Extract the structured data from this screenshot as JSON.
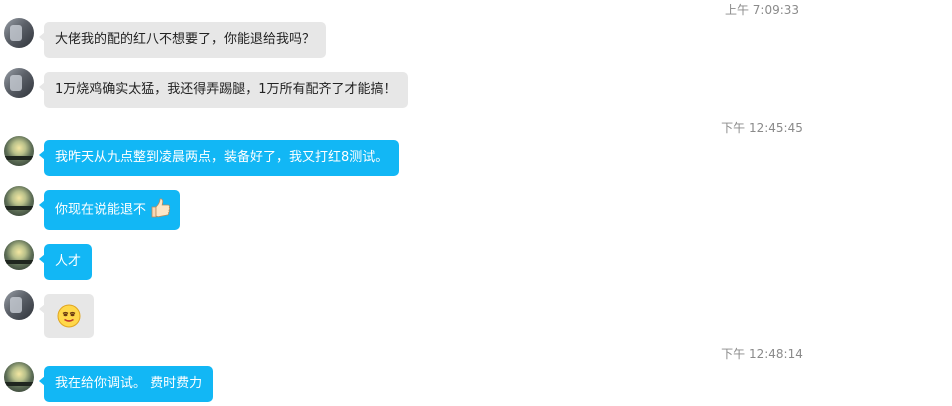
{
  "timestamps": [
    "上午 7:09:33",
    "下午 12:45:45",
    "下午 12:48:14"
  ],
  "messages": [
    {
      "text": "大佬我的配的红八不想要了，你能退给我吗？"
    },
    {
      "text": "1万烧鸡确实太猛，我还得弄踢腿，1万所有配齐了才能搞！"
    },
    {
      "text": "我昨天从九点整到凌晨两点，装备好了，我又打红8测试。"
    },
    {
      "text": "你现在说能退不"
    },
    {
      "text": "人才"
    },
    {
      "text": ""
    },
    {
      "text": "我在给你调试。 费时费力"
    }
  ],
  "icons": {
    "thumbs_up": "thumbs-up-icon",
    "smirk": "smirk-emoji-icon"
  },
  "colors": {
    "blue_bubble": "#12b7f5",
    "gray_bubble": "#e7e7e7",
    "timestamp": "#8a8a8a"
  }
}
